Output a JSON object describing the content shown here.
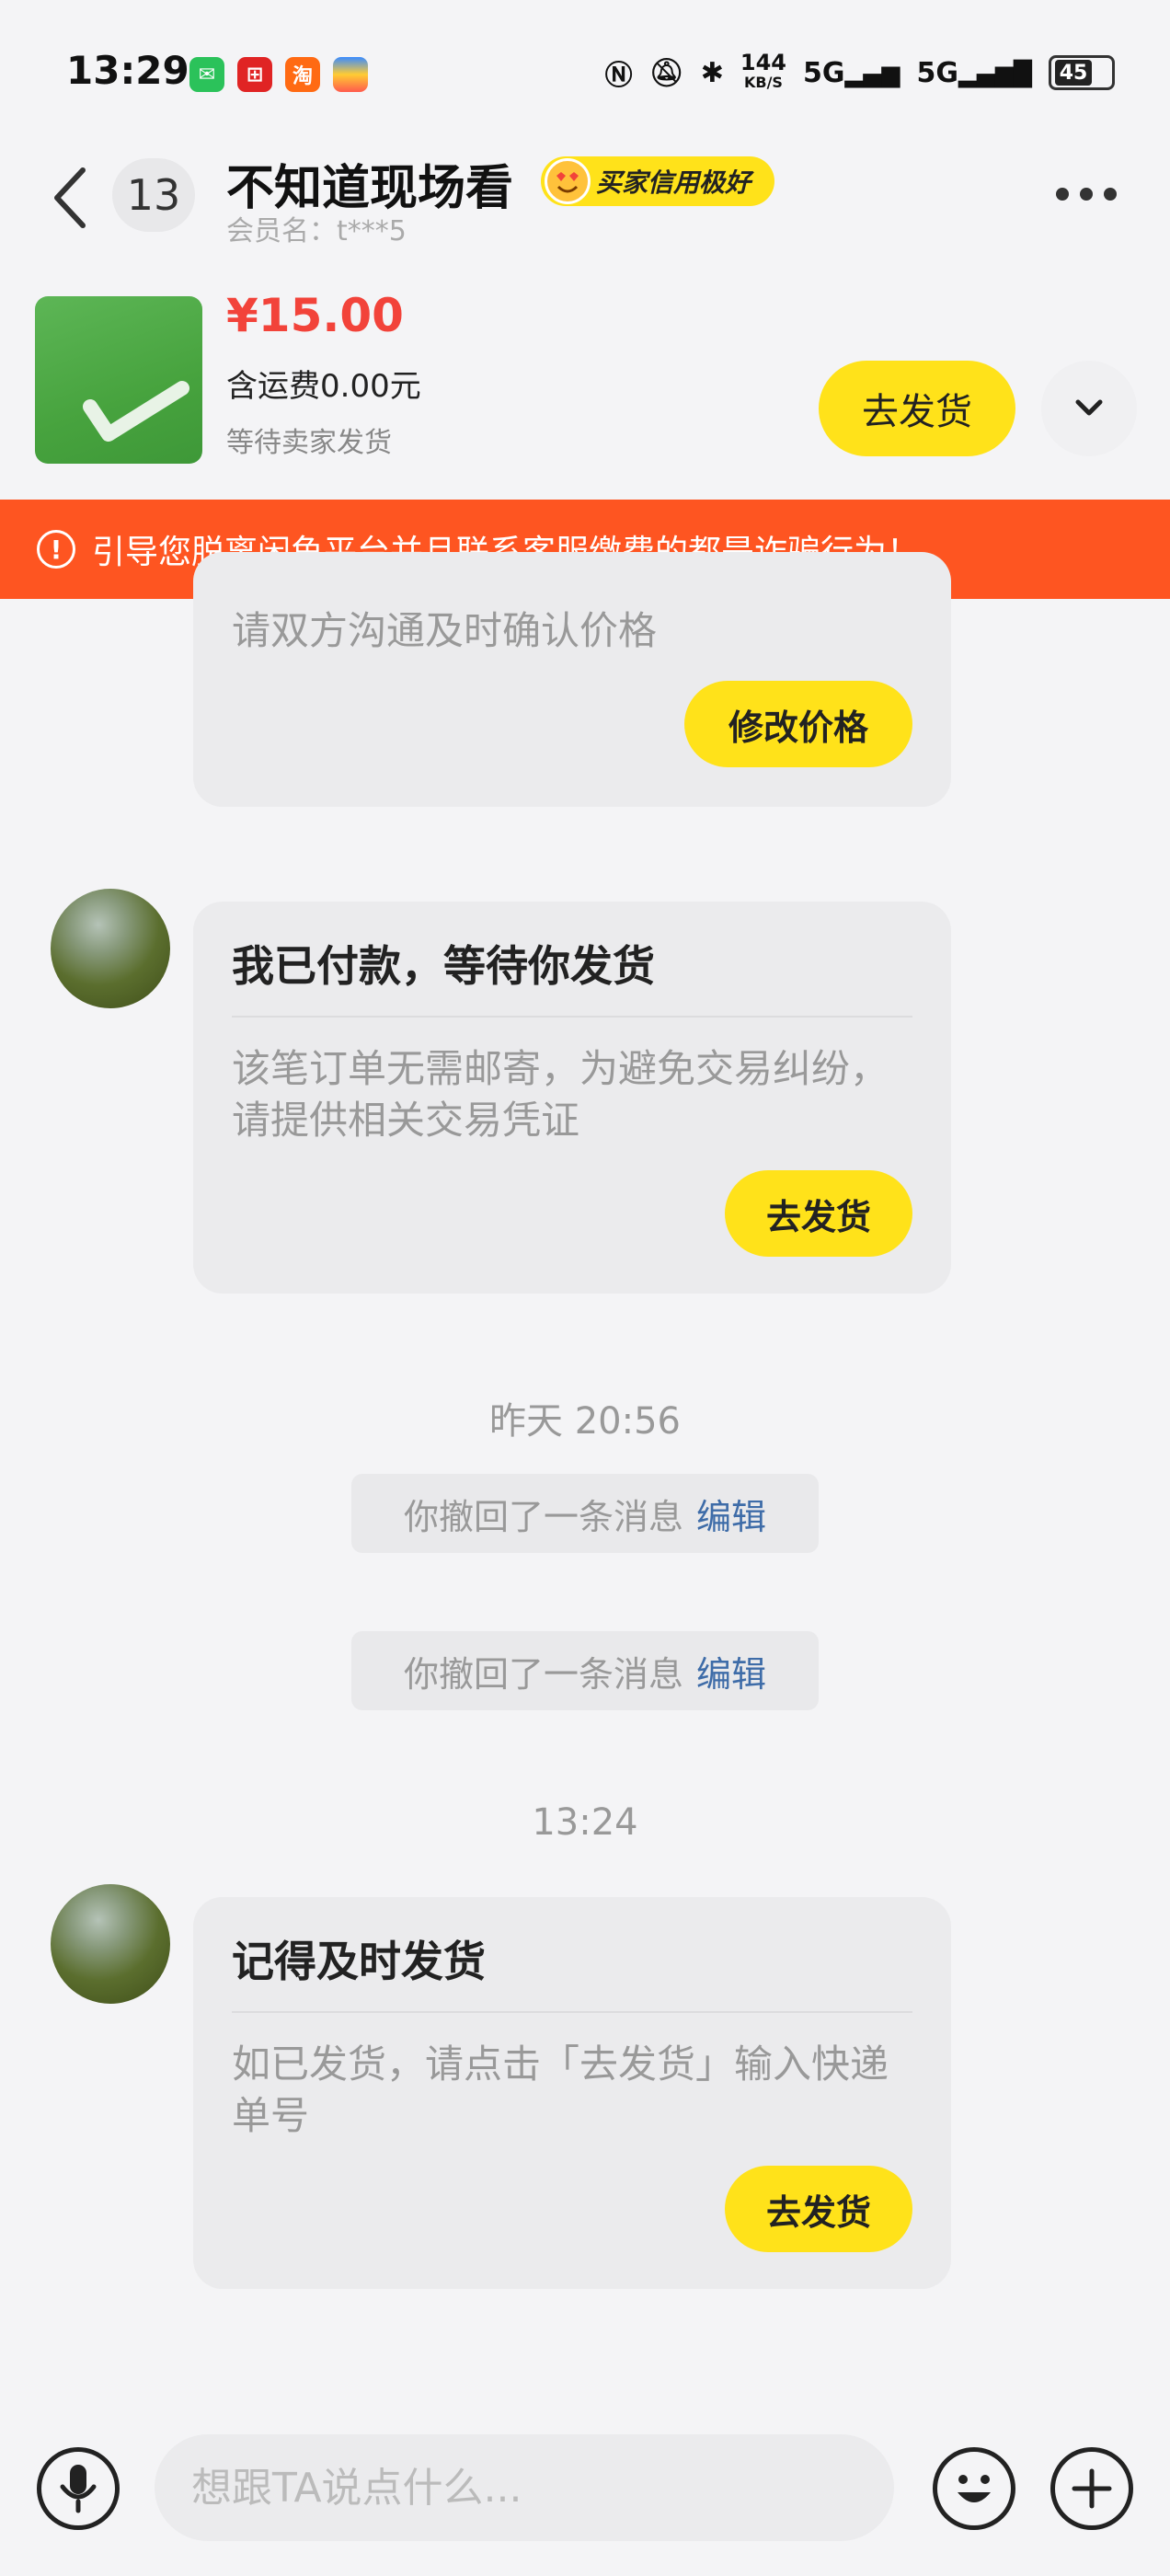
{
  "status_bar": {
    "time": "13:29",
    "net_speed": "144",
    "net_speed_unit": "KB/S",
    "signal_1": "5G",
    "signal_2": "5G",
    "battery": "45"
  },
  "header": {
    "unread_count": "13",
    "title": "不知道现场看",
    "credit_badge": "买家信用极好",
    "member_name": "会员名：t***5"
  },
  "product": {
    "price": "¥15.00",
    "shipping": "含运费0.00元",
    "status": "等待卖家发货",
    "ship_button": "去发货"
  },
  "warning": {
    "text": "引导您脱离闲鱼平台并且联系客服缴费的都是诈骗行为！"
  },
  "messages": {
    "card1": {
      "body": "请双方沟通及时确认价格",
      "button": "修改价格"
    },
    "card2": {
      "title": "我已付款，等待你发货",
      "body": "该笔订单无需邮寄，为避免交易纠纷，请提供相关交易凭证",
      "button": "去发货"
    },
    "timestamp1": "昨天 20:56",
    "recall1": {
      "text": "你撤回了一条消息",
      "edit": "编辑"
    },
    "recall2": {
      "text": "你撤回了一条消息",
      "edit": "编辑"
    },
    "timestamp2": "13:24",
    "card3": {
      "title": "记得及时发货",
      "body": "如已发货，请点击「去发货」输入快递单号",
      "button": "去发货"
    }
  },
  "input_bar": {
    "placeholder": "想跟TA说点什么..."
  },
  "colors": {
    "accent_yellow": "#ffe21a",
    "warning_orange": "#fe5521",
    "price_red": "#f2433a",
    "link_blue": "#3e6ca8"
  }
}
